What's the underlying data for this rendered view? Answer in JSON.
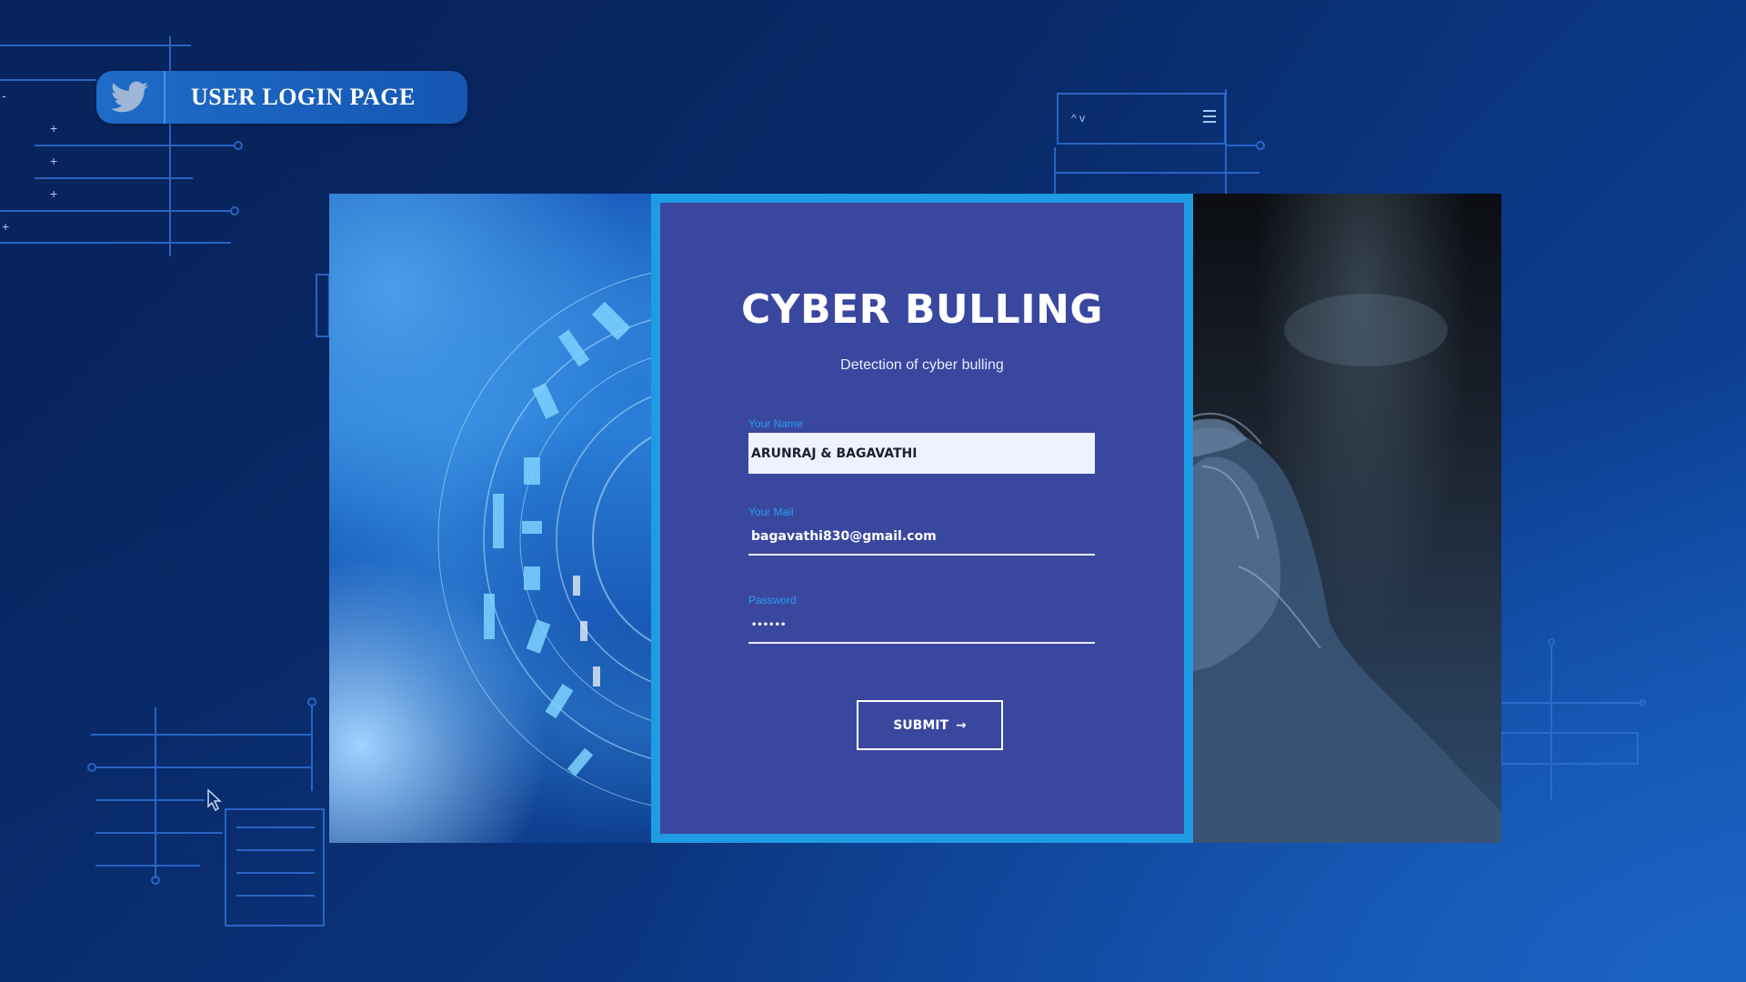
{
  "header": {
    "title": "USER LOGIN PAGE",
    "icon": "twitter-bird-icon"
  },
  "login": {
    "title": "CYBER BULLING",
    "subtitle": "Detection of cyber bulling",
    "name_label": "Your Name",
    "name_value": "ARUNRAJ & BAGAVATHI",
    "mail_label": "Your Mail",
    "mail_value": "bagavathi830@gmail.com",
    "password_label": "Password",
    "password_value": "••••••",
    "submit_label": "SUBMIT",
    "submit_icon": "arrow-right-icon"
  },
  "colors": {
    "background": "#0b2a63",
    "card": "#3a479f",
    "card_border": "#1e9be3",
    "label_accent": "#2a9df0",
    "badge": "#1e6cc8"
  }
}
